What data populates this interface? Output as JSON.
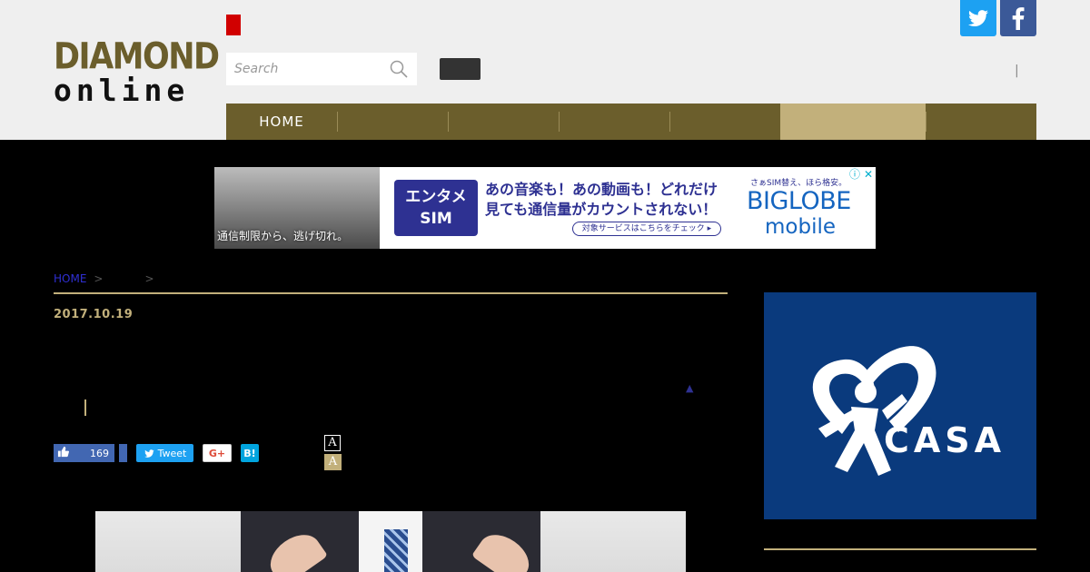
{
  "logo": {
    "line1": "DIAMOND",
    "line2": "online"
  },
  "search": {
    "placeholder": "Search"
  },
  "header": {
    "separator": "|"
  },
  "nav": {
    "items": [
      {
        "label": "HOME",
        "active": false
      },
      {
        "label": "",
        "active": false
      },
      {
        "label": "",
        "active": false
      },
      {
        "label": "",
        "active": false
      },
      {
        "label": "",
        "active": false
      },
      {
        "label": "",
        "active": true
      },
      {
        "label": "",
        "active": false
      }
    ]
  },
  "ad_banner": {
    "photo_caption": "通信制限から、逃げ切れ。",
    "badge_line1": "エンタメ",
    "badge_line2": "SIM",
    "copy_line1": "あの音楽も！あの動画も！どれだけ",
    "copy_line2": "見ても通信量がカウントされない！",
    "cta": "対象サービスはこちらをチェック ▸",
    "brand_sub": "さぁSIM替え、ほら格安。",
    "brand": "BIGLOBE",
    "brand2": "mobile",
    "info_icon": "ⓘ",
    "close_icon": "✕"
  },
  "breadcrumb": {
    "home": "HOME",
    "sep1": ">",
    "sep2": ">"
  },
  "article": {
    "date": "2017.10.19",
    "marker": "▲"
  },
  "share": {
    "like_count": "169",
    "tweet_label": "Tweet",
    "gplus_label": "G+",
    "hatena_label": "B!"
  },
  "font_size": {
    "small": "A",
    "large": "A"
  },
  "side_ad": {
    "brand": "CASA",
    "reg": "®"
  },
  "colors": {
    "brand_olive": "#6b5e2c",
    "nav_active": "#c2b07b",
    "twitter": "#1da1f2",
    "facebook": "#3b5998",
    "side_ad_blue": "#0a3a7d"
  }
}
